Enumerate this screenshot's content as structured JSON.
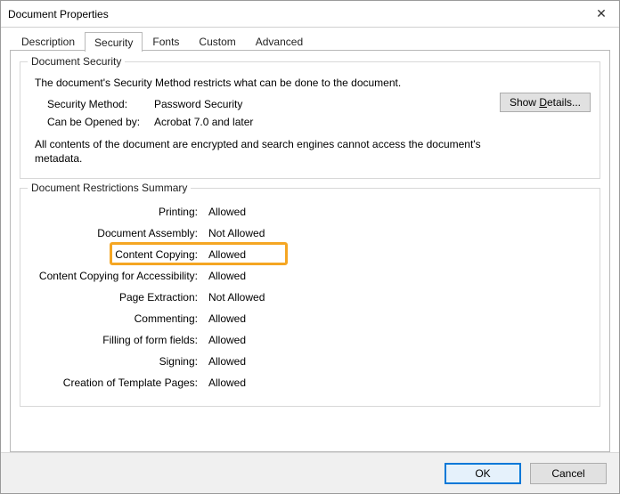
{
  "window": {
    "title": "Document Properties"
  },
  "tabs": {
    "description": "Description",
    "security": "Security",
    "fonts": "Fonts",
    "custom": "Custom",
    "advanced": "Advanced",
    "active": "security"
  },
  "security_group": {
    "legend": "Document Security",
    "description": "The document's Security Method restricts what can be done to the document.",
    "method_label": "Security Method:",
    "method_value": "Password Security",
    "openby_label": "Can be Opened by:",
    "openby_value": "Acrobat 7.0 and later",
    "encrypted_note": "All contents of the document are encrypted and search engines cannot access the document's metadata.",
    "show_details_prefix": "Show ",
    "show_details_u": "D",
    "show_details_suffix": "etails..."
  },
  "restrictions_group": {
    "legend": "Document Restrictions Summary",
    "items": [
      {
        "label": "Printing:",
        "value": "Allowed"
      },
      {
        "label": "Document Assembly:",
        "value": "Not Allowed"
      },
      {
        "label": "Content Copying:",
        "value": "Allowed"
      },
      {
        "label": "Content Copying for Accessibility:",
        "value": "Allowed"
      },
      {
        "label": "Page Extraction:",
        "value": "Not Allowed"
      },
      {
        "label": "Commenting:",
        "value": "Allowed"
      },
      {
        "label": "Filling of form fields:",
        "value": "Allowed"
      },
      {
        "label": "Signing:",
        "value": "Allowed"
      },
      {
        "label": "Creation of Template Pages:",
        "value": "Allowed"
      }
    ],
    "highlight_index": 2
  },
  "footer": {
    "ok": "OK",
    "cancel": "Cancel"
  }
}
